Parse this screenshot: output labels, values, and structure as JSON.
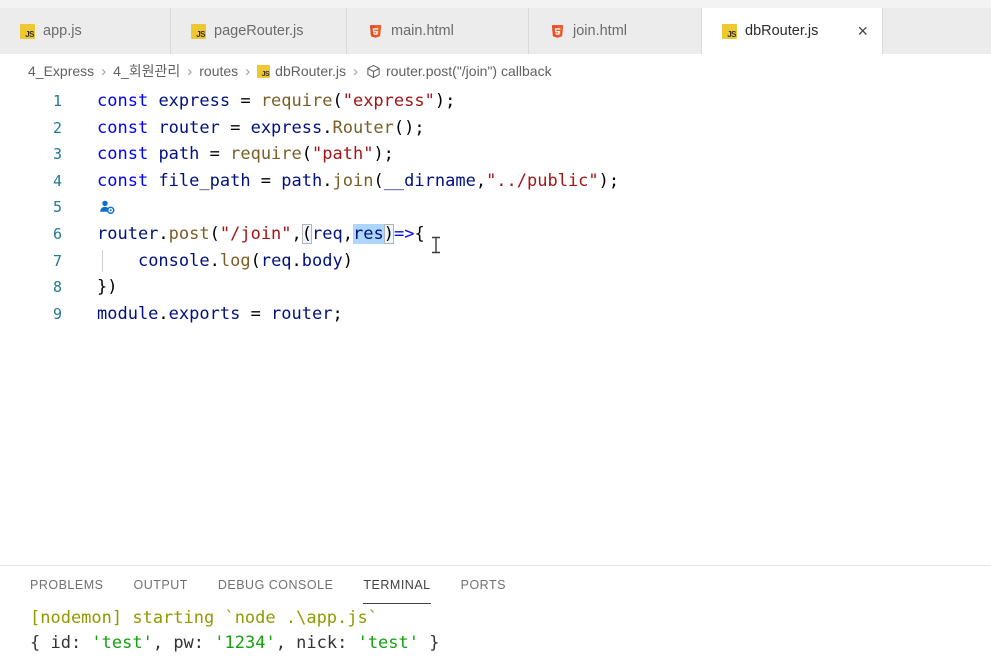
{
  "icons": {
    "close": "×",
    "chevron": "›",
    "js_label": "JS"
  },
  "tabs": [
    {
      "label": "app.js",
      "icon": "js",
      "active": false
    },
    {
      "label": "pageRouter.js",
      "icon": "js",
      "active": false
    },
    {
      "label": "main.html",
      "icon": "html",
      "active": false
    },
    {
      "label": "join.html",
      "icon": "html",
      "active": false
    },
    {
      "label": "dbRouter.js",
      "icon": "js",
      "active": true
    }
  ],
  "breadcrumb": [
    {
      "label": "4_Express"
    },
    {
      "label": "4_회원관리"
    },
    {
      "label": "routes"
    },
    {
      "label": "dbRouter.js",
      "icon": "js"
    },
    {
      "label": "router.post(\"/join\") callback",
      "icon": "symbol"
    }
  ],
  "editor": {
    "lines": [
      {
        "n": "1",
        "tokens": [
          {
            "c": "kw",
            "t": "const"
          },
          {
            "t": " "
          },
          {
            "c": "var",
            "t": "express"
          },
          {
            "t": " = "
          },
          {
            "c": "fn",
            "t": "require"
          },
          {
            "t": "("
          },
          {
            "c": "str",
            "t": "\"express\""
          },
          {
            "t": ");"
          }
        ]
      },
      {
        "n": "2",
        "tokens": [
          {
            "c": "kw",
            "t": "const"
          },
          {
            "t": " "
          },
          {
            "c": "var",
            "t": "router"
          },
          {
            "t": " = "
          },
          {
            "c": "var",
            "t": "express"
          },
          {
            "t": "."
          },
          {
            "c": "fn",
            "t": "Router"
          },
          {
            "t": "();"
          }
        ]
      },
      {
        "n": "3",
        "tokens": [
          {
            "c": "kw",
            "t": "const"
          },
          {
            "t": " "
          },
          {
            "c": "var",
            "t": "path"
          },
          {
            "t": " = "
          },
          {
            "c": "fn",
            "t": "require"
          },
          {
            "t": "("
          },
          {
            "c": "str",
            "t": "\"path\""
          },
          {
            "t": ");"
          }
        ]
      },
      {
        "n": "4",
        "tokens": [
          {
            "c": "kw",
            "t": "const"
          },
          {
            "t": " "
          },
          {
            "c": "var",
            "t": "file_path"
          },
          {
            "t": " = "
          },
          {
            "c": "var",
            "t": "path"
          },
          {
            "t": "."
          },
          {
            "c": "fn",
            "t": "join"
          },
          {
            "t": "("
          },
          {
            "c": "var",
            "t": "__dirname"
          },
          {
            "t": ","
          },
          {
            "c": "str",
            "t": "\"../public\""
          },
          {
            "t": ");"
          }
        ]
      },
      {
        "n": "5",
        "icon": "person-badge",
        "tokens": []
      },
      {
        "n": "6",
        "tokens": [
          {
            "c": "var",
            "t": "router"
          },
          {
            "t": "."
          },
          {
            "c": "fn",
            "t": "post"
          },
          {
            "t": "("
          },
          {
            "c": "str",
            "t": "\"/join\""
          },
          {
            "t": ","
          },
          {
            "c": "br",
            "t": "("
          },
          {
            "c": "var",
            "t": "req"
          },
          {
            "t": ","
          },
          {
            "c": "var sel",
            "t": "res"
          },
          {
            "c": "br",
            "t": ")"
          },
          {
            "c": "kw",
            "t": "=>"
          },
          {
            "t": "{"
          }
        ]
      },
      {
        "n": "7",
        "guide": true,
        "tokens": [
          {
            "t": "    "
          },
          {
            "c": "var",
            "t": "console"
          },
          {
            "t": "."
          },
          {
            "c": "fn",
            "t": "log"
          },
          {
            "t": "("
          },
          {
            "c": "var",
            "t": "req"
          },
          {
            "t": "."
          },
          {
            "c": "var",
            "t": "body"
          },
          {
            "t": ")"
          }
        ]
      },
      {
        "n": "8",
        "tokens": [
          {
            "t": "})"
          }
        ]
      },
      {
        "n": "9",
        "tokens": [
          {
            "c": "var",
            "t": "module"
          },
          {
            "t": "."
          },
          {
            "c": "var",
            "t": "exports"
          },
          {
            "t": " = "
          },
          {
            "c": "var",
            "t": "router"
          },
          {
            "t": ";"
          }
        ]
      }
    ]
  },
  "panel": {
    "tabs": [
      {
        "label": "PROBLEMS",
        "active": false
      },
      {
        "label": "OUTPUT",
        "active": false
      },
      {
        "label": "DEBUG CONSOLE",
        "active": false
      },
      {
        "label": "TERMINAL",
        "active": true
      },
      {
        "label": "PORTS",
        "active": false
      }
    ]
  },
  "terminal": {
    "lines": [
      {
        "tokens": [
          {
            "c": "y",
            "t": "[nodemon] starting `node .\\app.js`"
          }
        ]
      },
      {
        "tokens": [
          {
            "t": "{ id: "
          },
          {
            "c": "g",
            "t": "'test'"
          },
          {
            "t": ", pw: "
          },
          {
            "c": "g",
            "t": "'1234'"
          },
          {
            "t": ", nick: "
          },
          {
            "c": "g",
            "t": "'test'"
          },
          {
            "t": " }"
          }
        ]
      }
    ]
  },
  "colors": {
    "keyword": "#0000FF",
    "variable": "#001080",
    "function": "#795E26",
    "string": "#A31515",
    "line_number": "#237893",
    "selection": "#ADD6FF",
    "terminal_yellow": "#949800",
    "terminal_green": "#13A10E",
    "tabbar_bg": "#ececec",
    "active_tab_bg": "#ffffff"
  }
}
